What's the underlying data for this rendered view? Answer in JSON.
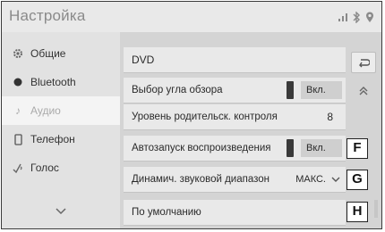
{
  "header": {
    "title": "Настройка"
  },
  "sidebar": {
    "items": [
      {
        "label": "Общие",
        "icon": "gear-icon"
      },
      {
        "label": "Bluetooth",
        "icon": "bluetooth-icon"
      },
      {
        "label": "Аудио",
        "icon": "music-note-icon"
      },
      {
        "label": "Телефон",
        "icon": "phone-icon"
      },
      {
        "label": "Голос",
        "icon": "voice-icon"
      }
    ],
    "active_index": 2
  },
  "panel": {
    "section_title": "DVD",
    "rows": [
      {
        "label": "Выбор угла обзора",
        "type": "toggle",
        "value": "Вкл."
      },
      {
        "label": "Уровень родительск. контроля",
        "type": "number",
        "value": "8"
      },
      {
        "label": "Автозапуск воспроизведения",
        "type": "toggle",
        "value": "Вкл."
      },
      {
        "label": "Динамич. звуковой диапазон",
        "type": "select",
        "value": "МАКС."
      },
      {
        "label": "По умолчанию",
        "type": "button"
      }
    ]
  },
  "callouts": {
    "f": "F",
    "g": "G",
    "h": "H"
  },
  "colors": {
    "background": "#d9d9d9",
    "row": "#e9e9e9",
    "indicator": "#3a3a3a"
  }
}
